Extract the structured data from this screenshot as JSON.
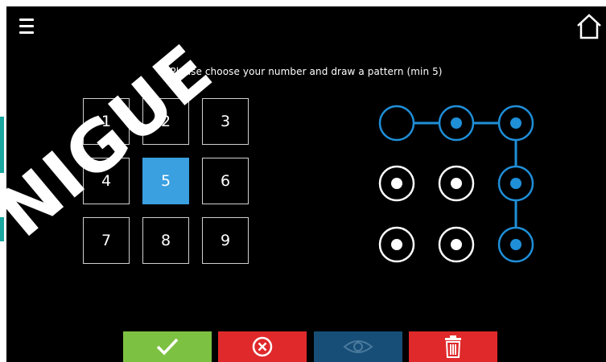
{
  "prompt": "Please choose your number and draw a pattern (min 5)",
  "watermark_text": "NIGUE",
  "numpad": {
    "keys": [
      "1",
      "2",
      "3",
      "4",
      "5",
      "6",
      "7",
      "8",
      "9"
    ],
    "selected": "5"
  },
  "pattern": {
    "grid": "3x3",
    "nodes_active": [
      1,
      2,
      5,
      8
    ],
    "nodes_empty": [
      0
    ],
    "path_order": [
      0,
      1,
      2,
      5,
      8
    ]
  },
  "toolbar": {
    "confirm_icon": "check-icon",
    "cancel_icon": "cancel-circle-icon",
    "show_icon": "eye-icon",
    "delete_icon": "trash-icon"
  },
  "colors": {
    "accent_blue": "#3aa0e0",
    "pattern_blue": "#1f8fd8",
    "ok_green": "#7dc142",
    "cancel_red": "#e0292b",
    "show_navy": "#174e78"
  }
}
